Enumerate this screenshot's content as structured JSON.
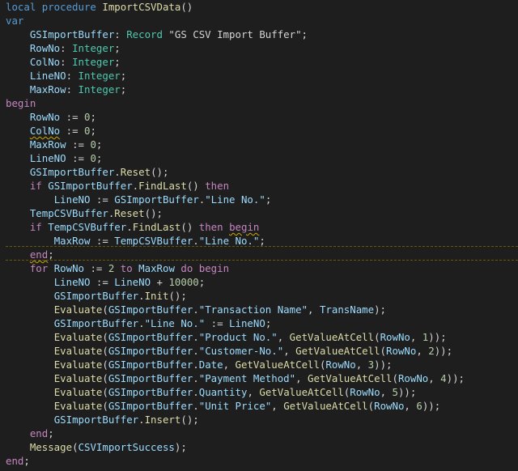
{
  "colors": {
    "background": "#1e1e1e",
    "keyword": "#569cd6",
    "control": "#c586c0",
    "function": "#dcdcaa",
    "variable": "#9cdcfe",
    "type": "#4ec9b0",
    "string": "#ce9178",
    "number": "#b5cea8",
    "plain": "#d4d4d4",
    "squiggle": "#cca700"
  },
  "code": {
    "lines": [
      [
        {
          "t": "local procedure ",
          "c": "keyword"
        },
        {
          "t": "ImportCSVData",
          "c": "function"
        },
        {
          "t": "()",
          "c": "plain"
        }
      ],
      [
        {
          "t": "var",
          "c": "keyword"
        }
      ],
      [
        {
          "t": "    ",
          "c": "plain"
        },
        {
          "t": "GSImportBuffer",
          "c": "var"
        },
        {
          "t": ": ",
          "c": "plain"
        },
        {
          "t": "Record ",
          "c": "type"
        },
        {
          "t": "\"GS CSV Import Buffer\"",
          "c": "plain"
        },
        {
          "t": ";",
          "c": "plain"
        }
      ],
      [
        {
          "t": "    ",
          "c": "plain"
        },
        {
          "t": "RowNo",
          "c": "var"
        },
        {
          "t": ": ",
          "c": "plain"
        },
        {
          "t": "Integer",
          "c": "type"
        },
        {
          "t": ";",
          "c": "plain"
        }
      ],
      [
        {
          "t": "    ",
          "c": "plain"
        },
        {
          "t": "ColNo",
          "c": "var"
        },
        {
          "t": ": ",
          "c": "plain"
        },
        {
          "t": "Integer",
          "c": "type"
        },
        {
          "t": ";",
          "c": "plain"
        }
      ],
      [
        {
          "t": "    ",
          "c": "plain"
        },
        {
          "t": "LineNO",
          "c": "var"
        },
        {
          "t": ": ",
          "c": "plain"
        },
        {
          "t": "Integer",
          "c": "type"
        },
        {
          "t": ";",
          "c": "plain"
        }
      ],
      [
        {
          "t": "    ",
          "c": "plain"
        },
        {
          "t": "MaxRow",
          "c": "var"
        },
        {
          "t": ": ",
          "c": "plain"
        },
        {
          "t": "Integer",
          "c": "type"
        },
        {
          "t": ";",
          "c": "plain"
        }
      ],
      [
        {
          "t": "begin",
          "c": "control"
        }
      ],
      [
        {
          "t": "    ",
          "c": "plain"
        },
        {
          "t": "RowNo",
          "c": "var"
        },
        {
          "t": " := ",
          "c": "plain"
        },
        {
          "t": "0",
          "c": "number"
        },
        {
          "t": ";",
          "c": "plain"
        }
      ],
      [
        {
          "t": "    ",
          "c": "plain"
        },
        {
          "t": "ColNo",
          "c": "var",
          "sq": true
        },
        {
          "t": " := ",
          "c": "plain"
        },
        {
          "t": "0",
          "c": "number"
        },
        {
          "t": ";",
          "c": "plain"
        }
      ],
      [
        {
          "t": "    ",
          "c": "plain"
        },
        {
          "t": "MaxRow",
          "c": "var"
        },
        {
          "t": " := ",
          "c": "plain"
        },
        {
          "t": "0",
          "c": "number"
        },
        {
          "t": ";",
          "c": "plain"
        }
      ],
      [
        {
          "t": "    ",
          "c": "plain"
        },
        {
          "t": "LineNO",
          "c": "var"
        },
        {
          "t": " := ",
          "c": "plain"
        },
        {
          "t": "0",
          "c": "number"
        },
        {
          "t": ";",
          "c": "plain"
        }
      ],
      [
        {
          "t": "    ",
          "c": "plain"
        },
        {
          "t": "GSImportBuffer",
          "c": "var"
        },
        {
          "t": ".",
          "c": "plain"
        },
        {
          "t": "Reset",
          "c": "function"
        },
        {
          "t": "();",
          "c": "plain"
        }
      ],
      [
        {
          "t": "    ",
          "c": "plain"
        },
        {
          "t": "if ",
          "c": "control"
        },
        {
          "t": "GSImportBuffer",
          "c": "var"
        },
        {
          "t": ".",
          "c": "plain"
        },
        {
          "t": "FindLast",
          "c": "function"
        },
        {
          "t": "() ",
          "c": "plain"
        },
        {
          "t": "then",
          "c": "control"
        }
      ],
      [
        {
          "t": "        ",
          "c": "plain"
        },
        {
          "t": "LineNO",
          "c": "var"
        },
        {
          "t": " := ",
          "c": "plain"
        },
        {
          "t": "GSImportBuffer",
          "c": "var"
        },
        {
          "t": ".",
          "c": "plain"
        },
        {
          "t": "\"Line No.\"",
          "c": "var"
        },
        {
          "t": ";",
          "c": "plain"
        }
      ],
      [
        {
          "t": "    ",
          "c": "plain"
        },
        {
          "t": "TempCSVBuffer",
          "c": "var"
        },
        {
          "t": ".",
          "c": "plain"
        },
        {
          "t": "Reset",
          "c": "function"
        },
        {
          "t": "();",
          "c": "plain"
        }
      ],
      [
        {
          "t": "    ",
          "c": "plain"
        },
        {
          "t": "if ",
          "c": "control"
        },
        {
          "t": "TempCSVBuffer",
          "c": "var"
        },
        {
          "t": ".",
          "c": "plain"
        },
        {
          "t": "FindLast",
          "c": "function"
        },
        {
          "t": "() ",
          "c": "plain"
        },
        {
          "t": "then ",
          "c": "control"
        },
        {
          "t": "begin",
          "c": "control",
          "sq": true
        }
      ],
      [
        {
          "t": "        ",
          "c": "plain"
        },
        {
          "t": "MaxRow",
          "c": "var"
        },
        {
          "t": " := ",
          "c": "plain"
        },
        {
          "t": "TempCSVBuffer",
          "c": "var"
        },
        {
          "t": ".",
          "c": "plain"
        },
        {
          "t": "\"Line No.\"",
          "c": "var"
        },
        {
          "t": ";",
          "c": "plain"
        }
      ],
      [
        {
          "t": "    ",
          "c": "plain"
        },
        {
          "t": "end",
          "c": "control",
          "sq": true
        },
        {
          "t": ";",
          "c": "plain"
        }
      ],
      [
        {
          "t": "    ",
          "c": "plain"
        },
        {
          "t": "for ",
          "c": "control"
        },
        {
          "t": "RowNo",
          "c": "var"
        },
        {
          "t": " := ",
          "c": "plain"
        },
        {
          "t": "2",
          "c": "number"
        },
        {
          "t": " to ",
          "c": "control"
        },
        {
          "t": "MaxRow",
          "c": "var"
        },
        {
          "t": " do begin",
          "c": "control"
        }
      ],
      [
        {
          "t": "        ",
          "c": "plain"
        },
        {
          "t": "LineNO",
          "c": "var"
        },
        {
          "t": " := ",
          "c": "plain"
        },
        {
          "t": "LineNO",
          "c": "var"
        },
        {
          "t": " + ",
          "c": "plain"
        },
        {
          "t": "10000",
          "c": "number"
        },
        {
          "t": ";",
          "c": "plain"
        }
      ],
      [
        {
          "t": "        ",
          "c": "plain"
        },
        {
          "t": "GSImportBuffer",
          "c": "var"
        },
        {
          "t": ".",
          "c": "plain"
        },
        {
          "t": "Init",
          "c": "function"
        },
        {
          "t": "();",
          "c": "plain"
        }
      ],
      [
        {
          "t": "        ",
          "c": "plain"
        },
        {
          "t": "Evaluate",
          "c": "function"
        },
        {
          "t": "(",
          "c": "plain"
        },
        {
          "t": "GSImportBuffer",
          "c": "var"
        },
        {
          "t": ".",
          "c": "plain"
        },
        {
          "t": "\"Transaction Name\"",
          "c": "var"
        },
        {
          "t": ", ",
          "c": "plain"
        },
        {
          "t": "TransName",
          "c": "var"
        },
        {
          "t": ");",
          "c": "plain"
        }
      ],
      [
        {
          "t": "        ",
          "c": "plain"
        },
        {
          "t": "GSImportBuffer",
          "c": "var"
        },
        {
          "t": ".",
          "c": "plain"
        },
        {
          "t": "\"Line No.\"",
          "c": "var"
        },
        {
          "t": " := ",
          "c": "plain"
        },
        {
          "t": "LineNO",
          "c": "var"
        },
        {
          "t": ";",
          "c": "plain"
        }
      ],
      [
        {
          "t": "        ",
          "c": "plain"
        },
        {
          "t": "Evaluate",
          "c": "function"
        },
        {
          "t": "(",
          "c": "plain"
        },
        {
          "t": "GSImportBuffer",
          "c": "var"
        },
        {
          "t": ".",
          "c": "plain"
        },
        {
          "t": "\"Product No.\"",
          "c": "var"
        },
        {
          "t": ", ",
          "c": "plain"
        },
        {
          "t": "GetValueAtCell",
          "c": "function"
        },
        {
          "t": "(",
          "c": "plain"
        },
        {
          "t": "RowNo",
          "c": "var"
        },
        {
          "t": ", ",
          "c": "plain"
        },
        {
          "t": "1",
          "c": "number"
        },
        {
          "t": "));",
          "c": "plain"
        }
      ],
      [
        {
          "t": "        ",
          "c": "plain"
        },
        {
          "t": "Evaluate",
          "c": "function"
        },
        {
          "t": "(",
          "c": "plain"
        },
        {
          "t": "GSImportBuffer",
          "c": "var"
        },
        {
          "t": ".",
          "c": "plain"
        },
        {
          "t": "\"Customer-No.\"",
          "c": "var"
        },
        {
          "t": ", ",
          "c": "plain"
        },
        {
          "t": "GetValueAtCell",
          "c": "function"
        },
        {
          "t": "(",
          "c": "plain"
        },
        {
          "t": "RowNo",
          "c": "var"
        },
        {
          "t": ", ",
          "c": "plain"
        },
        {
          "t": "2",
          "c": "number"
        },
        {
          "t": "));",
          "c": "plain"
        }
      ],
      [
        {
          "t": "        ",
          "c": "plain"
        },
        {
          "t": "Evaluate",
          "c": "function"
        },
        {
          "t": "(",
          "c": "plain"
        },
        {
          "t": "GSImportBuffer",
          "c": "var"
        },
        {
          "t": ".",
          "c": "plain"
        },
        {
          "t": "Date",
          "c": "var"
        },
        {
          "t": ", ",
          "c": "plain"
        },
        {
          "t": "GetValueAtCell",
          "c": "function"
        },
        {
          "t": "(",
          "c": "plain"
        },
        {
          "t": "RowNo",
          "c": "var"
        },
        {
          "t": ", ",
          "c": "plain"
        },
        {
          "t": "3",
          "c": "number"
        },
        {
          "t": "));",
          "c": "plain"
        }
      ],
      [
        {
          "t": "        ",
          "c": "plain"
        },
        {
          "t": "Evaluate",
          "c": "function"
        },
        {
          "t": "(",
          "c": "plain"
        },
        {
          "t": "GSImportBuffer",
          "c": "var"
        },
        {
          "t": ".",
          "c": "plain"
        },
        {
          "t": "\"Payment Method\"",
          "c": "var"
        },
        {
          "t": ", ",
          "c": "plain"
        },
        {
          "t": "GetValueAtCell",
          "c": "function"
        },
        {
          "t": "(",
          "c": "plain"
        },
        {
          "t": "RowNo",
          "c": "var"
        },
        {
          "t": ", ",
          "c": "plain"
        },
        {
          "t": "4",
          "c": "number"
        },
        {
          "t": "));",
          "c": "plain"
        }
      ],
      [
        {
          "t": "        ",
          "c": "plain"
        },
        {
          "t": "Evaluate",
          "c": "function"
        },
        {
          "t": "(",
          "c": "plain"
        },
        {
          "t": "GSImportBuffer",
          "c": "var"
        },
        {
          "t": ".",
          "c": "plain"
        },
        {
          "t": "Quantity",
          "c": "var"
        },
        {
          "t": ", ",
          "c": "plain"
        },
        {
          "t": "GetValueAtCell",
          "c": "function"
        },
        {
          "t": "(",
          "c": "plain"
        },
        {
          "t": "RowNo",
          "c": "var"
        },
        {
          "t": ", ",
          "c": "plain"
        },
        {
          "t": "5",
          "c": "number"
        },
        {
          "t": "));",
          "c": "plain"
        }
      ],
      [
        {
          "t": "        ",
          "c": "plain"
        },
        {
          "t": "Evaluate",
          "c": "function"
        },
        {
          "t": "(",
          "c": "plain"
        },
        {
          "t": "GSImportBuffer",
          "c": "var"
        },
        {
          "t": ".",
          "c": "plain"
        },
        {
          "t": "\"Unit Price\"",
          "c": "var"
        },
        {
          "t": ", ",
          "c": "plain"
        },
        {
          "t": "GetValueAtCell",
          "c": "function"
        },
        {
          "t": "(",
          "c": "plain"
        },
        {
          "t": "RowNo",
          "c": "var"
        },
        {
          "t": ", ",
          "c": "plain"
        },
        {
          "t": "6",
          "c": "number"
        },
        {
          "t": "));",
          "c": "plain"
        }
      ],
      [
        {
          "t": "        ",
          "c": "plain"
        },
        {
          "t": "GSImportBuffer",
          "c": "var"
        },
        {
          "t": ".",
          "c": "plain"
        },
        {
          "t": "Insert",
          "c": "function"
        },
        {
          "t": "();",
          "c": "plain"
        }
      ],
      [
        {
          "t": "    ",
          "c": "plain"
        },
        {
          "t": "end",
          "c": "control"
        },
        {
          "t": ";",
          "c": "plain"
        }
      ],
      [
        {
          "t": "    ",
          "c": "plain"
        },
        {
          "t": "Message",
          "c": "function"
        },
        {
          "t": "(",
          "c": "plain"
        },
        {
          "t": "CSVImportSuccess",
          "c": "var"
        },
        {
          "t": ");",
          "c": "plain"
        }
      ],
      [
        {
          "t": "end",
          "c": "control"
        },
        {
          "t": ";",
          "c": "plain"
        }
      ]
    ]
  }
}
